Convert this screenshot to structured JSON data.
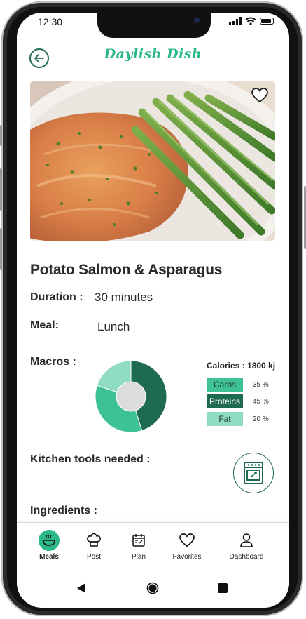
{
  "status_bar": {
    "time": "12:30"
  },
  "header": {
    "app_title": "Daylish Dish"
  },
  "recipe": {
    "name": "Potato Salmon & Asparagus",
    "duration_label": "Duration :",
    "duration_value": "30 minutes",
    "meal_label": "Meal:",
    "meal_value": "Lunch",
    "macros_label": "Macros :",
    "calories": "Calories : 1800 kj",
    "macros": [
      {
        "name": "Carbs",
        "percent_text": "35 %",
        "percent": 35,
        "color": "#3ec193",
        "text_color": "#1d3b30"
      },
      {
        "name": "Proteins",
        "percent_text": "45 %",
        "percent": 45,
        "color": "#1e6b52",
        "text_color": "#ffffff"
      },
      {
        "name": "Fat",
        "percent_text": "20 %",
        "percent": 20,
        "color": "#8fdcc0",
        "text_color": "#1d3b30"
      }
    ],
    "kitchen_tools_label": "Kitchen tools needed :",
    "ingredients_label": "Ingredients :"
  },
  "tabs": [
    {
      "label": "Meals",
      "icon": "bowl-icon",
      "active": true
    },
    {
      "label": "Post",
      "icon": "chef-hat-icon",
      "active": false
    },
    {
      "label": "Plan",
      "icon": "calendar-icon",
      "active": false
    },
    {
      "label": "Favorites",
      "icon": "heart-icon",
      "active": false
    },
    {
      "label": "Dashboard",
      "icon": "user-icon",
      "active": false
    }
  ],
  "colors": {
    "accent": "#2bb98a",
    "dark_green": "#1e6b52",
    "light_green": "#8fdcc0"
  }
}
